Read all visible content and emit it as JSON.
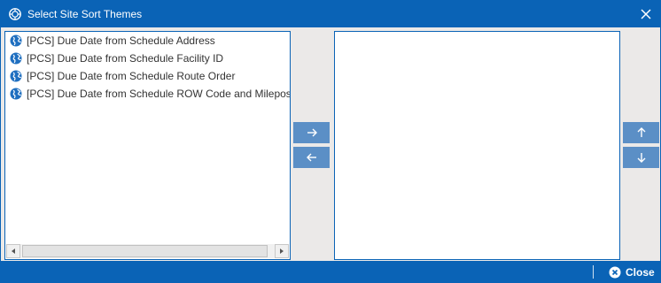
{
  "window": {
    "title": "Select Site Sort Themes",
    "app_icon": "app-logo-icon",
    "close_icon": "close-icon"
  },
  "available_themes": {
    "items": [
      {
        "label": "[PCS] Due Date from Schedule Address",
        "icon": "globe-icon"
      },
      {
        "label": "[PCS] Due Date from Schedule Facility ID",
        "icon": "globe-icon"
      },
      {
        "label": "[PCS] Due Date from Schedule Route Order",
        "icon": "globe-icon"
      },
      {
        "label": "[PCS] Due Date from Schedule ROW Code and Milepost",
        "icon": "globe-icon"
      }
    ]
  },
  "selected_themes": {
    "items": []
  },
  "transfer_buttons": {
    "add_icon": "arrow-right-icon",
    "remove_icon": "arrow-left-icon"
  },
  "order_buttons": {
    "up_icon": "arrow-up-icon",
    "down_icon": "arrow-down-icon"
  },
  "footer": {
    "close_label": "Close",
    "close_icon": "close-circle-icon"
  },
  "colors": {
    "primary": "#0a63b6",
    "button": "#5b8fc6",
    "background": "#ebe9e8",
    "globe": "#1f6fc0"
  }
}
